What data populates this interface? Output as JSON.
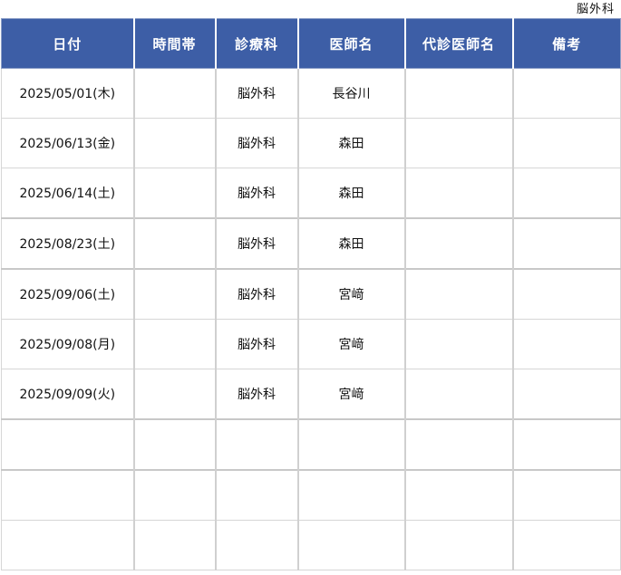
{
  "department_label": "脳外科",
  "table": {
    "headers": [
      "日付",
      "時間帯",
      "診療科",
      "医師名",
      "代診医師名",
      "備考"
    ],
    "rows": [
      [
        "2025/05/01(木)",
        "",
        "脳外科",
        "長谷川",
        "",
        ""
      ],
      [
        "2025/06/13(金)",
        "",
        "脳外科",
        "森田",
        "",
        ""
      ],
      [
        "2025/06/14(土)",
        "",
        "脳外科",
        "森田",
        "",
        ""
      ],
      [
        "2025/08/23(土)",
        "",
        "脳外科",
        "森田",
        "",
        ""
      ],
      [
        "2025/09/06(土)",
        "",
        "脳外科",
        "宮﨑",
        "",
        ""
      ],
      [
        "2025/09/08(月)",
        "",
        "脳外科",
        "宮﨑",
        "",
        ""
      ],
      [
        "2025/09/09(火)",
        "",
        "脳外科",
        "宮﨑",
        "",
        ""
      ],
      [
        "",
        "",
        "",
        "",
        "",
        ""
      ],
      [
        "",
        "",
        "",
        "",
        "",
        ""
      ],
      [
        "",
        "",
        "",
        "",
        "",
        ""
      ]
    ]
  }
}
